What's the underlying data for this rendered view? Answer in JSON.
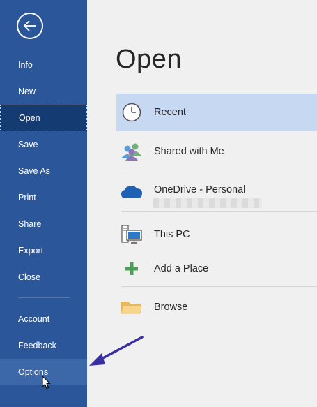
{
  "sidebar": {
    "back_icon": "back-arrow-icon",
    "items": [
      {
        "label": "Info"
      },
      {
        "label": "New"
      },
      {
        "label": "Open"
      },
      {
        "label": "Save"
      },
      {
        "label": "Save As"
      },
      {
        "label": "Print"
      },
      {
        "label": "Share"
      },
      {
        "label": "Export"
      },
      {
        "label": "Close"
      },
      {
        "label": "Account"
      },
      {
        "label": "Feedback"
      },
      {
        "label": "Options"
      }
    ],
    "selected": "Open",
    "hovered": "Options"
  },
  "main": {
    "title": "Open",
    "locations": [
      {
        "label": "Recent",
        "icon": "clock-icon"
      },
      {
        "label": "Shared with Me",
        "icon": "people-icon"
      },
      {
        "label": "OneDrive - Personal",
        "icon": "cloud-icon"
      },
      {
        "label": "This PC",
        "icon": "computer-icon"
      },
      {
        "label": "Add a Place",
        "icon": "plus-icon"
      },
      {
        "label": "Browse",
        "icon": "folder-icon"
      }
    ]
  },
  "colors": {
    "sidebar": "#2b579a",
    "sidebar_selected": "#143b72",
    "location_selected": "#c7d8f3",
    "arrow": "#3a2fa0"
  }
}
